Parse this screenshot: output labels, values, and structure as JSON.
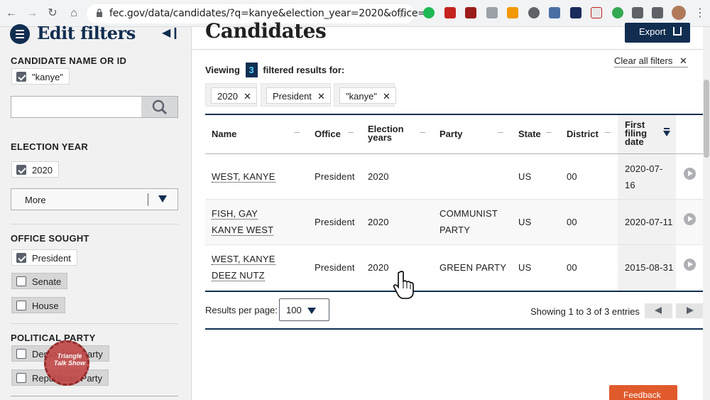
{
  "browser": {
    "url": "fec.gov/data/candidates/?q=kanye&election_year=2020&office=P"
  },
  "sidebar": {
    "title": "Edit filters",
    "candidate_heading": "CANDIDATE NAME OR ID",
    "candidate_chip": "\"kanye\"",
    "election_year_heading": "ELECTION YEAR",
    "election_year_chip": "2020",
    "more_label": "More",
    "office_heading": "OFFICE SOUGHT",
    "offices": [
      "President",
      "Senate",
      "House"
    ],
    "party_heading": "POLITICAL PARTY",
    "parties": [
      "Democratic Party",
      "Republican Party"
    ],
    "watermark_text": "Triangle Talk Show"
  },
  "main": {
    "title": "Candidates",
    "export_label": "Export",
    "viewing_prefix": "Viewing",
    "viewing_count": "3",
    "viewing_suffix": "filtered results for:",
    "clear_all": "Clear all filters",
    "filter_tags": [
      "2020",
      "President",
      "\"kanye\""
    ],
    "columns": [
      "Name",
      "Office",
      "Election years",
      "Party",
      "State",
      "District",
      "First filing date"
    ],
    "rows": [
      {
        "name": "WEST, KANYE",
        "office": "President",
        "years": "2020",
        "party": "",
        "state": "US",
        "district": "00",
        "filing": "2020-07-16"
      },
      {
        "name": "FISH, GAY KANYE WEST",
        "office": "President",
        "years": "2020",
        "party": "COMMUNIST PARTY",
        "state": "US",
        "district": "00",
        "filing": "2020-07-11"
      },
      {
        "name": "WEST, KANYE DEEZ NUTZ",
        "office": "President",
        "years": "2020",
        "party": "GREEN PARTY",
        "state": "US",
        "district": "00",
        "filing": "2015-08-31"
      }
    ],
    "results_per_page_label": "Results per page:",
    "results_per_page_value": "100",
    "showing_text": "Showing 1 to 3 of 3 entries",
    "feedback_label": "Feedback"
  },
  "colors": {
    "navy": "#112e51",
    "feedback": "#e05a2c",
    "count_text": "#4fd1ff"
  }
}
